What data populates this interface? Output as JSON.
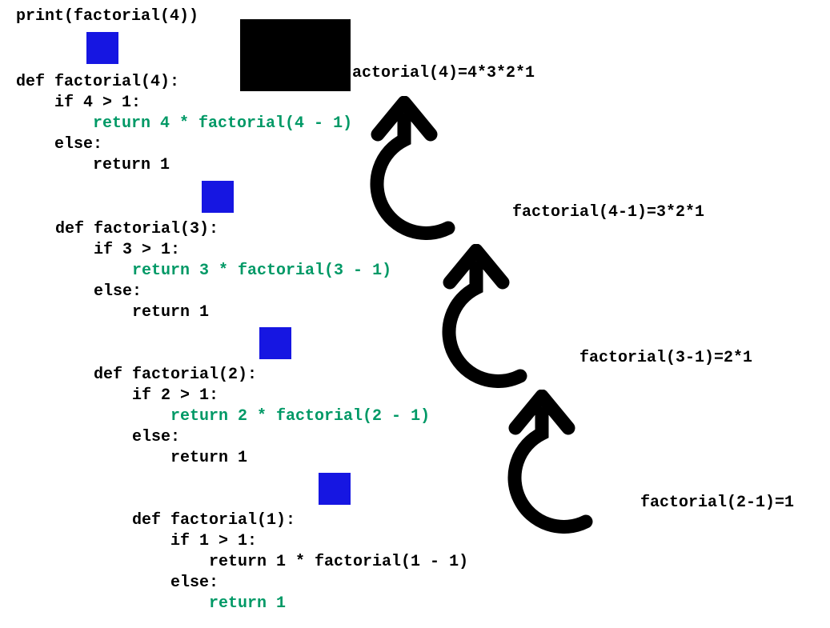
{
  "print_line": "print(factorial(4))",
  "blocks": [
    {
      "def": "def factorial(4):",
      "ifl": "    if 4 > 1:",
      "ret": "        return 4 * factorial(4 - 1)",
      "elsel": "    else:",
      "ret1": "        return 1",
      "highlight": "return"
    },
    {
      "def": "def factorial(3):",
      "ifl": "    if 3 > 1:",
      "ret": "        return 3 * factorial(3 - 1)",
      "elsel": "    else:",
      "ret1": "        return 1",
      "highlight": "return"
    },
    {
      "def": "def factorial(2):",
      "ifl": "    if 2 > 1:",
      "ret": "        return 2 * factorial(2 - 1)",
      "elsel": "    else:",
      "ret1": "        return 1",
      "highlight": "return"
    },
    {
      "def": "def factorial(1):",
      "ifl": "    if 1 > 1:",
      "ret": "        return 1 * factorial(1 - 1)",
      "elsel": "    else:",
      "ret1": "        return 1",
      "highlight": "else"
    }
  ],
  "annotations": {
    "a0": "actorial(4)=4*3*2*1",
    "a1": "factorial(4-1)=3*2*1",
    "a2": "factorial(3-1)=2*1",
    "a3": "factorial(2-1)=1"
  },
  "colors": {
    "highlight": "#009966",
    "blue": "#1616e2",
    "black": "#000000"
  }
}
